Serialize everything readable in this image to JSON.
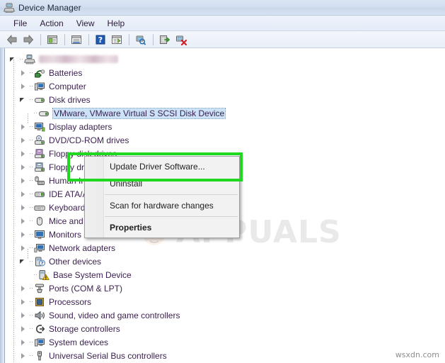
{
  "window": {
    "title": "Device Manager",
    "icon": "device-manager-icon"
  },
  "menubar": {
    "items": [
      {
        "label": "File",
        "name": "menu-file"
      },
      {
        "label": "Action",
        "name": "menu-action"
      },
      {
        "label": "View",
        "name": "menu-view"
      },
      {
        "label": "Help",
        "name": "menu-help"
      }
    ]
  },
  "toolbar": {
    "buttons": [
      {
        "icon": "back-arrow-icon",
        "name": "toolbar-back"
      },
      {
        "icon": "forward-arrow-icon",
        "name": "toolbar-forward"
      },
      {
        "icon": "show-hide-console-tree-icon",
        "name": "toolbar-console-tree"
      },
      {
        "icon": "properties-icon",
        "name": "toolbar-properties"
      },
      {
        "icon": "help-icon",
        "name": "toolbar-help"
      },
      {
        "icon": "show-hide-action-pane-icon",
        "name": "toolbar-action-pane"
      },
      {
        "icon": "scan-hardware-changes-icon",
        "name": "toolbar-scan-hardware"
      },
      {
        "icon": "update-driver-icon",
        "name": "toolbar-update-driver"
      },
      {
        "icon": "uninstall-device-icon",
        "name": "toolbar-uninstall-device"
      }
    ]
  },
  "tree": {
    "root": {
      "label": "",
      "redacted": true,
      "icon": "computer-root-icon",
      "state": "expanded"
    },
    "items": [
      {
        "label": "Batteries",
        "icon": "battery-icon",
        "state": "collapsed",
        "indent": 1
      },
      {
        "label": "Computer",
        "icon": "computer-icon",
        "state": "collapsed",
        "indent": 1
      },
      {
        "label": "Disk drives",
        "icon": "disk-drive-icon",
        "state": "expanded",
        "indent": 1
      },
      {
        "label": "VMware, VMware Virtual S SCSI Disk Device",
        "icon": "disk-icon",
        "state": "leaf",
        "indent": 2,
        "selected": true
      },
      {
        "label": "Display adapters",
        "icon": "display-adapter-icon",
        "state": "collapsed",
        "indent": 1
      },
      {
        "label": "DVD/CD-ROM drives",
        "icon": "dvd-drive-icon",
        "state": "collapsed",
        "indent": 1
      },
      {
        "label": "Floppy disk drives",
        "icon": "floppy-drive-icon",
        "state": "collapsed",
        "indent": 1
      },
      {
        "label": "Floppy drive controllers",
        "icon": "floppy-controller-icon",
        "state": "collapsed",
        "indent": 1
      },
      {
        "label": "Human Interface Devices",
        "icon": "hid-icon",
        "state": "collapsed",
        "indent": 1
      },
      {
        "label": "IDE ATA/ATAPI controllers",
        "icon": "ide-controller-icon",
        "state": "collapsed",
        "indent": 1
      },
      {
        "label": "Keyboards",
        "icon": "keyboard-icon",
        "state": "collapsed",
        "indent": 1
      },
      {
        "label": "Mice and other pointing devices",
        "icon": "mouse-icon",
        "state": "collapsed",
        "indent": 1
      },
      {
        "label": "Monitors",
        "icon": "monitor-icon",
        "state": "collapsed",
        "indent": 1
      },
      {
        "label": "Network adapters",
        "icon": "network-adapter-icon",
        "state": "collapsed",
        "indent": 1
      },
      {
        "label": "Other devices",
        "icon": "other-devices-icon",
        "state": "expanded",
        "indent": 1
      },
      {
        "label": "Base System Device",
        "icon": "unknown-device-warning-icon",
        "state": "leaf",
        "indent": 2
      },
      {
        "label": "Ports (COM & LPT)",
        "icon": "ports-icon",
        "state": "collapsed",
        "indent": 1
      },
      {
        "label": "Processors",
        "icon": "processor-icon",
        "state": "collapsed",
        "indent": 1
      },
      {
        "label": "Sound, video and game controllers",
        "icon": "sound-icon",
        "state": "collapsed",
        "indent": 1
      },
      {
        "label": "Storage controllers",
        "icon": "storage-controller-icon",
        "state": "collapsed",
        "indent": 1
      },
      {
        "label": "System devices",
        "icon": "system-devices-icon",
        "state": "collapsed",
        "indent": 1
      },
      {
        "label": "Universal Serial Bus controllers",
        "icon": "usb-icon",
        "state": "collapsed",
        "indent": 1
      }
    ]
  },
  "context_menu": {
    "items": [
      {
        "label": "Update Driver Software...",
        "name": "ctx-update-driver-software",
        "bold": false
      },
      {
        "label": "Uninstall",
        "name": "ctx-uninstall",
        "bold": false
      },
      {
        "separator": true
      },
      {
        "label": "Scan for hardware changes",
        "name": "ctx-scan-for-hardware-changes",
        "bold": false
      },
      {
        "separator": true
      },
      {
        "label": "Properties",
        "name": "ctx-properties",
        "bold": true
      }
    ]
  },
  "annotations": {
    "highlight_color": "#1fd81f",
    "highlight_target": "Update Driver Software..."
  },
  "watermark": {
    "text": "APPUALS"
  },
  "credit": {
    "text": "wsxdn.com"
  }
}
